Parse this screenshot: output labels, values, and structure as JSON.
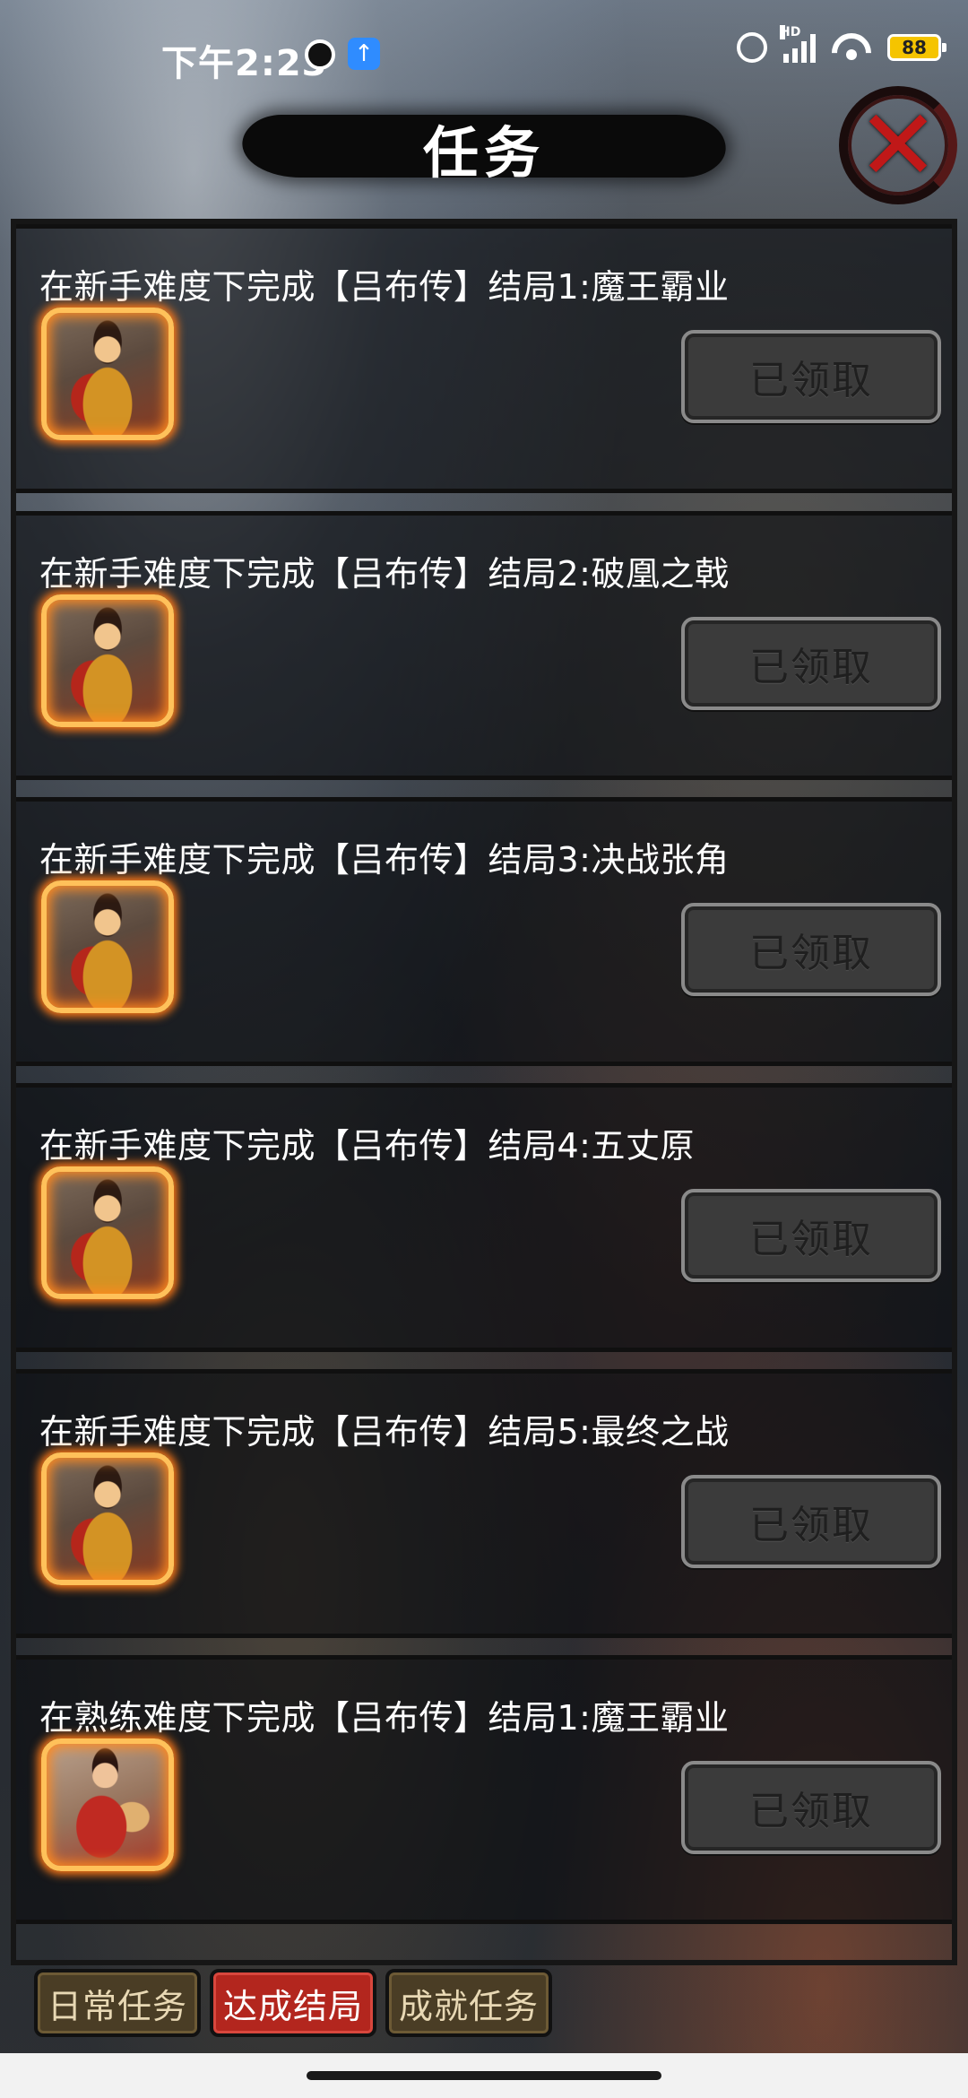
{
  "status_bar": {
    "time": "下午2:23",
    "network_label": "HD",
    "battery": "88"
  },
  "header": {
    "title": "任务"
  },
  "tasks": [
    {
      "title": "在新手难度下完成【吕布传】结局1:魔王霸业",
      "button_label": "已领取",
      "portrait": "lubu-armor"
    },
    {
      "title": "在新手难度下完成【吕布传】结局2:破凰之戟",
      "button_label": "已领取",
      "portrait": "lubu-armor"
    },
    {
      "title": "在新手难度下完成【吕布传】结局3:决战张角",
      "button_label": "已领取",
      "portrait": "lubu-armor"
    },
    {
      "title": "在新手难度下完成【吕布传】结局4:五丈原",
      "button_label": "已领取",
      "portrait": "lubu-armor"
    },
    {
      "title": "在新手难度下完成【吕布传】结局5:最终之战",
      "button_label": "已领取",
      "portrait": "lubu-armor"
    },
    {
      "title": "在熟练难度下完成【吕布传】结局1:魔王霸业",
      "button_label": "已领取",
      "portrait": "lubu-bow"
    }
  ],
  "tabs": [
    {
      "label": "日常任务",
      "active": false
    },
    {
      "label": "达成结局",
      "active": true
    },
    {
      "label": "成就任务",
      "active": false
    }
  ],
  "colors": {
    "active_tab": "#b3261e",
    "inactive_tab": "#4a3d25",
    "avatar_glow": "#ff7a18",
    "close_x": "#c01818"
  }
}
